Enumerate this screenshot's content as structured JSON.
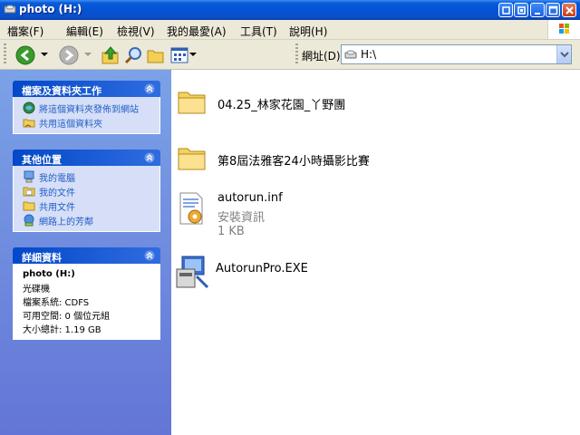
{
  "window": {
    "title": "photo (H:)"
  },
  "menu": [
    "檔案(F)",
    "編輯(E)",
    "檢視(V)",
    "我的最愛(A)",
    "工具(T)",
    "說明(H)"
  ],
  "address": {
    "label": "網址(D)",
    "value": "H:\\"
  },
  "task_pane": {
    "panels": [
      {
        "title": "檔案及資料夾工作",
        "items": [
          {
            "label": "將這個資料夾發佈到網站",
            "icon": "publish-web-icon"
          },
          {
            "label": "共用這個資料夾",
            "icon": "share-folder-icon"
          }
        ]
      },
      {
        "title": "其他位置",
        "items": [
          {
            "label": "我的電腦",
            "icon": "my-computer-icon"
          },
          {
            "label": "我的文件",
            "icon": "my-documents-icon"
          },
          {
            "label": "共用文件",
            "icon": "shared-documents-icon"
          },
          {
            "label": "網路上的芳鄰",
            "icon": "network-places-icon"
          }
        ]
      },
      {
        "title": "詳細資料",
        "lines": [
          "photo (H:)",
          "光碟機",
          "檔案系統: CDFS",
          "可用空間: 0 個位元組",
          "大小總計: 1.19 GB"
        ]
      }
    ]
  },
  "files": [
    {
      "name": "04.25_林家花園_丫野團",
      "type": "folder"
    },
    {
      "name": "第8屆法雅客24小時攝影比賽",
      "type": "folder"
    },
    {
      "name": "autorun.inf",
      "type": "setup-info",
      "desc": "安裝資訊",
      "size": "1 KB"
    },
    {
      "name": "AutorunPro.EXE",
      "type": "executable"
    }
  ],
  "colors": {
    "titlebar": "#0453d6",
    "taskpane": "#7ba2e7",
    "link": "#215dc6"
  }
}
